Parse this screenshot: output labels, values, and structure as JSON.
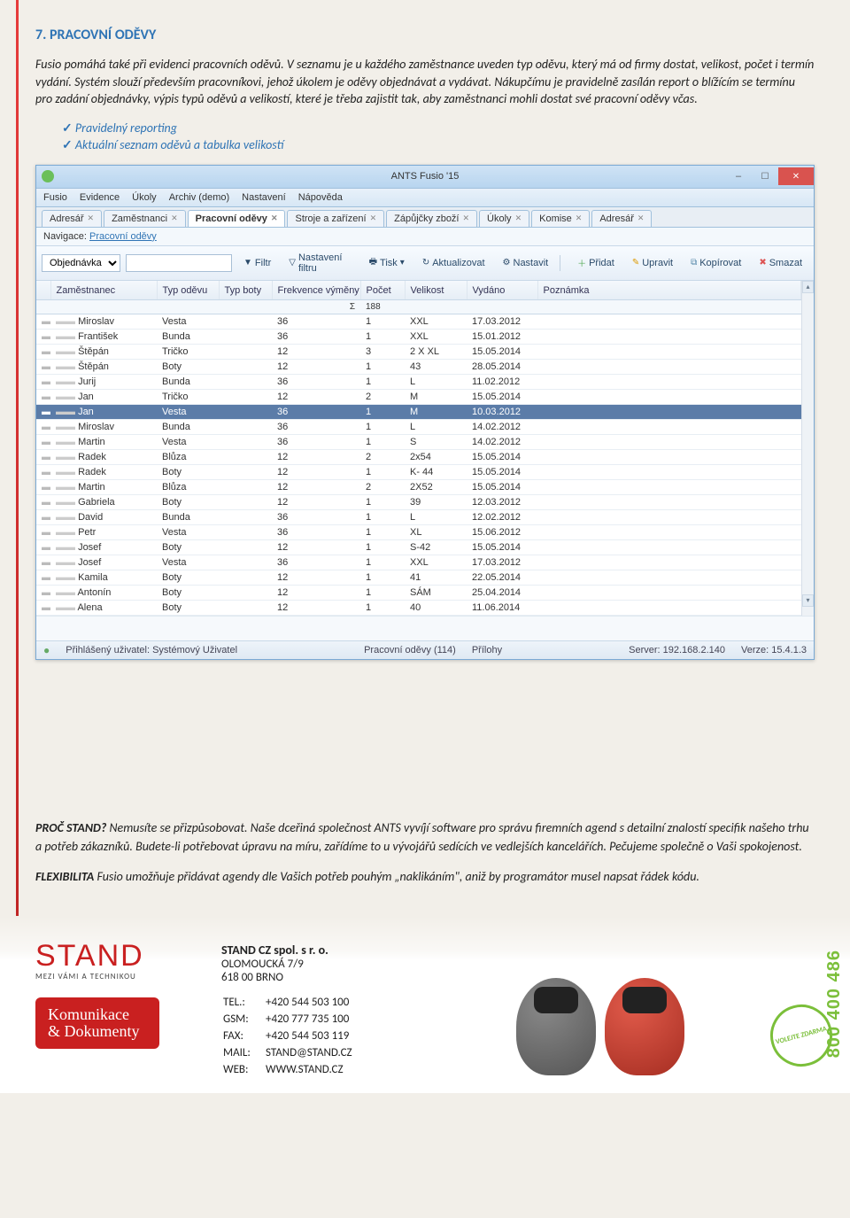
{
  "section": {
    "title": "7.  PRACOVNÍ ODĚVY",
    "para1": "Fusio pomáhá také při evidenci pracovních oděvů. V seznamu je u každého zaměstnance uveden typ oděvu, který má od firmy dostat, velikost, počet i termín vydání. Systém slouží především pracovníkovi, jehož úkolem je oděvy objednávat a vydávat. Nákupčímu je pravidelně zasílán report o blížícím se termínu pro zadání objednávky, výpis typů oděvů a velikostí, které je třeba zajistit tak, aby zaměstnanci mohli dostat své pracovní oděvy včas.",
    "bullets": [
      "Pravidelný reporting",
      "Aktuální seznam oděvů a tabulka velikostí"
    ]
  },
  "app": {
    "title": "ANTS Fusio '15",
    "menu": [
      "Fusio",
      "Evidence",
      "Úkoly",
      "Archiv (demo)",
      "Nastavení",
      "Nápověda"
    ],
    "tabs": [
      "Adresář",
      "Zaměstnanci",
      "Pracovní oděvy",
      "Stroje a zařízení",
      "Zápůjčky zboží",
      "Úkoly",
      "Komise",
      "Adresář"
    ],
    "activeTab": 2,
    "nav_label": "Navigace:",
    "nav_link": "Pracovní oděvy",
    "toolbar": {
      "dropdown": "Objednávka",
      "filtr": "Filtr",
      "nastaveni_filtru": "Nastavení filtru",
      "tisk": "Tisk",
      "aktualizovat": "Aktualizovat",
      "nastavit": "Nastavit",
      "pridat": "Přidat",
      "upravit": "Upravit",
      "kopirovat": "Kopírovat",
      "smazat": "Smazat"
    },
    "columns": [
      "Zaměstnanec",
      "Typ oděvu",
      "Typ boty",
      "Frekvence výměny",
      "Počet",
      "Velikost",
      "Vydáno",
      "Poznámka"
    ],
    "sum_sigma": "Σ",
    "sum_value": "188",
    "rows": [
      {
        "emp": "Miroslav",
        "typ": "Vesta",
        "frek": "36",
        "pocet": "1",
        "vel": "XXL",
        "vyd": "17.03.2012",
        "sel": false
      },
      {
        "emp": "František",
        "typ": "Bunda",
        "frek": "36",
        "pocet": "1",
        "vel": "XXL",
        "vyd": "15.01.2012",
        "sel": false
      },
      {
        "emp": "Štěpán",
        "typ": "Tričko",
        "frek": "12",
        "pocet": "3",
        "vel": "2 X XL",
        "vyd": "15.05.2014",
        "sel": false
      },
      {
        "emp": "Štěpán",
        "typ": "Boty",
        "frek": "12",
        "pocet": "1",
        "vel": "43",
        "vyd": "28.05.2014",
        "sel": false
      },
      {
        "emp": "Jurij",
        "typ": "Bunda",
        "frek": "36",
        "pocet": "1",
        "vel": "L",
        "vyd": "11.02.2012",
        "sel": false
      },
      {
        "emp": "Jan",
        "typ": "Tričko",
        "frek": "12",
        "pocet": "2",
        "vel": "M",
        "vyd": "15.05.2014",
        "sel": false
      },
      {
        "emp": "Jan",
        "typ": "Vesta",
        "frek": "36",
        "pocet": "1",
        "vel": "M",
        "vyd": "10.03.2012",
        "sel": true
      },
      {
        "emp": "Miroslav",
        "typ": "Bunda",
        "frek": "36",
        "pocet": "1",
        "vel": "L",
        "vyd": "14.02.2012",
        "sel": false
      },
      {
        "emp": "Martin",
        "typ": "Vesta",
        "frek": "36",
        "pocet": "1",
        "vel": "S",
        "vyd": "14.02.2012",
        "sel": false
      },
      {
        "emp": "Radek",
        "typ": "Blůza",
        "frek": "12",
        "pocet": "2",
        "vel": "2x54",
        "vyd": "15.05.2014",
        "sel": false
      },
      {
        "emp": "Radek",
        "typ": "Boty",
        "frek": "12",
        "pocet": "1",
        "vel": "K- 44",
        "vyd": "15.05.2014",
        "sel": false
      },
      {
        "emp": "Martin",
        "typ": "Blůza",
        "frek": "12",
        "pocet": "2",
        "vel": "2X52",
        "vyd": "15.05.2014",
        "sel": false
      },
      {
        "emp": "Gabriela",
        "typ": "Boty",
        "frek": "12",
        "pocet": "1",
        "vel": "39",
        "vyd": "12.03.2012",
        "sel": false
      },
      {
        "emp": "David",
        "typ": "Bunda",
        "frek": "36",
        "pocet": "1",
        "vel": "L",
        "vyd": "12.02.2012",
        "sel": false
      },
      {
        "emp": "Petr",
        "typ": "Vesta",
        "frek": "36",
        "pocet": "1",
        "vel": "XL",
        "vyd": "15.06.2012",
        "sel": false
      },
      {
        "emp": "Josef",
        "typ": "Boty",
        "frek": "12",
        "pocet": "1",
        "vel": "S-42",
        "vyd": "15.05.2014",
        "sel": false
      },
      {
        "emp": "Josef",
        "typ": "Vesta",
        "frek": "36",
        "pocet": "1",
        "vel": "XXL",
        "vyd": "17.03.2012",
        "sel": false
      },
      {
        "emp": "Kamila",
        "typ": "Boty",
        "frek": "12",
        "pocet": "1",
        "vel": "41",
        "vyd": "22.05.2014",
        "sel": false
      },
      {
        "emp": "Antonín",
        "typ": "Boty",
        "frek": "12",
        "pocet": "1",
        "vel": "SÁM",
        "vyd": "25.04.2014",
        "sel": false
      },
      {
        "emp": "Alena",
        "typ": "Boty",
        "frek": "12",
        "pocet": "1",
        "vel": "40",
        "vyd": "11.06.2014",
        "sel": false
      }
    ],
    "status": {
      "user_label": "Přihlášený uživatel: Systémový Uživatel",
      "center1": "Pracovní oděvy (114)",
      "center2": "Přílohy",
      "server": "Server: 192.168.2.140",
      "version": "Verze: 15.4.1.3"
    }
  },
  "closing": {
    "p1_bold": "PROČ STAND?",
    "p1_rest": " Nemusíte se přizpůsobovat. Naše dceřiná společnost ANTS vyvíjí software pro správu firemních agend s detailní znalostí specifik našeho trhu a potřeb zákazníků. Budete-li potřebovat úpravu na míru, zařídíme to u vývojářů sedících ve vedlejších kancelářích. Pečujeme společně o Vaši spokojenost.",
    "p2_bold": "FLEXIBILITA",
    "p2_rest": " Fusio umožňuje přidávat agendy dle Vašich potřeb pouhým „naklikáním\", aniž by programátor musel napsat řádek kódu."
  },
  "footer": {
    "logo": "STAND",
    "logo_sub": "MEZI VÁMI A TECHNIKOU",
    "kd1": "Komunikace",
    "kd2": "& Dokumenty",
    "company": "STAND CZ spol. s r. o.",
    "addr1": "OLOMOUCKÁ 7/9",
    "addr2": "618 00 BRNO",
    "contacts": [
      [
        "TEL.:",
        "+420 544 503 100"
      ],
      [
        "GSM:",
        "+420 777 735 100"
      ],
      [
        "FAX:",
        "+420 544 503 119"
      ],
      [
        "MAIL:",
        "STAND@STAND.CZ"
      ],
      [
        "WEB:",
        "WWW.STAND.CZ"
      ]
    ],
    "phone_big": "800 400 486",
    "badge": "VOLEJTE ZDARMA"
  }
}
